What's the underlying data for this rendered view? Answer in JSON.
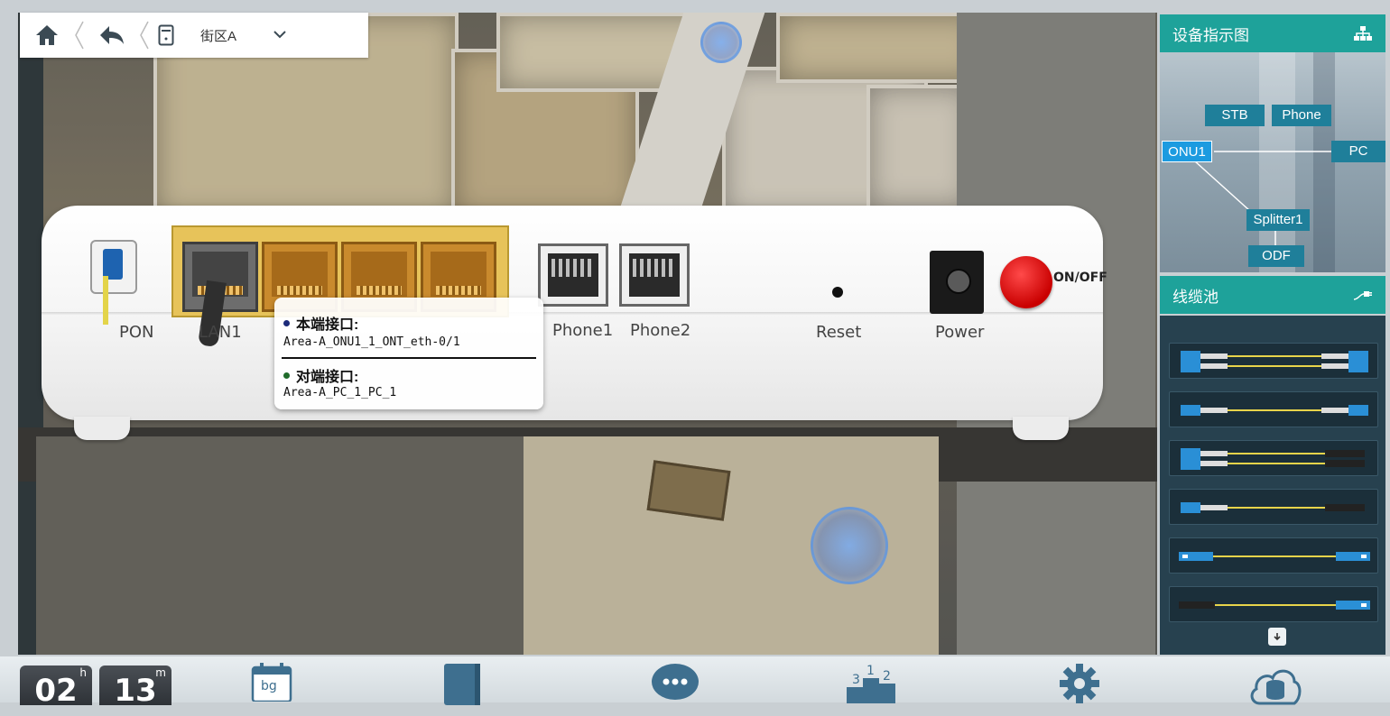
{
  "toolbar": {
    "home_icon": "home-icon",
    "back_icon": "back-arrow-icon",
    "device_icon": "device-icon",
    "location": "街区A",
    "dropdown_icon": "chevron-down-icon"
  },
  "device": {
    "ports": {
      "pon": "PON",
      "lan1": "LAN1",
      "phone1": "Phone1",
      "phone2": "Phone2",
      "reset": "Reset",
      "power": "Power",
      "onoff": "ON/OFF"
    },
    "tooltip": {
      "local_label": "本端接口:",
      "local_value": "Area-A_ONU1_1_ONT_eth-0/1",
      "remote_label": "对端接口:",
      "remote_value": "Area-A_PC_1_PC_1"
    }
  },
  "panel": {
    "diagram_title": "设备指示图",
    "diagram_icon": "network-topology-icon",
    "nodes": {
      "stb": "STB",
      "phone": "Phone",
      "onu1": "ONU1",
      "pc": "PC",
      "splitter1": "Splitter1",
      "odf": "ODF"
    },
    "pool_title": "线缆池",
    "pool_icon": "cable-plug-icon",
    "cables": [
      {
        "name": "SC-SC duplex patch cord"
      },
      {
        "name": "SC-SC simplex patch cord"
      },
      {
        "name": "SC-FC duplex patch cord"
      },
      {
        "name": "SC-FC simplex patch cord"
      },
      {
        "name": "LC-LC patch cord"
      },
      {
        "name": "FC-LC patch cord"
      }
    ],
    "scroll_down_icon": "arrow-down-icon"
  },
  "bottom": {
    "clock_hours": "02",
    "clock_hours_unit": "h",
    "clock_minutes": "13",
    "clock_minutes_unit": "m",
    "calendar_label": "bg",
    "icons": [
      "calendar-icon",
      "notebook-icon",
      "chat-icon",
      "ranking-icon",
      "settings-gear-icon",
      "database-icon"
    ]
  },
  "colors": {
    "accent": "#1ea29a",
    "panel_bg": "#27414f",
    "node_bg": "#1f7f9a",
    "node_active": "#1c9be0",
    "onoff_red": "#e00000",
    "lan_yellow": "#e7c35a"
  }
}
